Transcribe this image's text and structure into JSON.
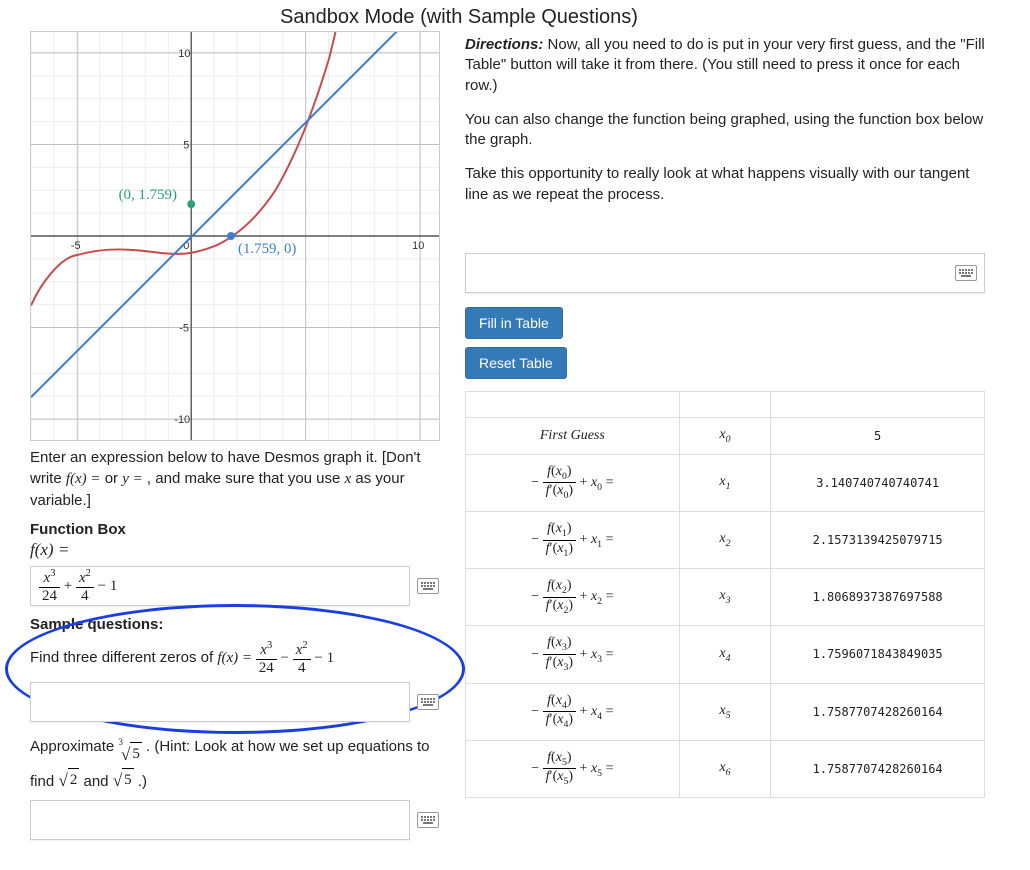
{
  "page": {
    "title": "Sandbox Mode (with Sample Questions)"
  },
  "directions": {
    "label": "Directions:",
    "p1": " Now, all you need to do is put in your very first guess, and the \"Fill Table\" button will take it from there. (You still need to press it once for each row.)",
    "p2": "You can also change the function being graphed, using the function box below the graph.",
    "p3": "Take this opportunity to really look at what happens visually with our tangent line as we repeat the process."
  },
  "graph": {
    "axis_ticks": [
      "10",
      "5",
      "-5",
      "0",
      "10",
      "-5",
      "-10"
    ],
    "pt1_label": "(0, 1.759)",
    "pt2_label": "(1.759, 0)"
  },
  "left_panel": {
    "enter_expr_a": "Enter an expression below to have Desmos graph it. [Don't write ",
    "enter_expr_b": " , and make sure that you use ",
    "enter_expr_c": " as your variable.]",
    "fx_eq": "f(x) =",
    "or": " or ",
    "y_eq": "y =",
    "x_var": "x",
    "fn_box_label": "Function Box",
    "fn_box_prefix": "f(x) =",
    "fn_box_value": "x³⁄24 + x²⁄4 − 1",
    "sample_heading": "Sample questions:",
    "sample_q1_a": "Find three different zeros of ",
    "sample_q1_b": "f(x) = ",
    "sample_q2_a": "Approximate ",
    "cube_root_5": "∛5",
    "sample_q2_b": " . (Hint: Look at how we set up equations to find ",
    "sqrt2": "√2",
    "and": " and ",
    "sqrt5": "√5",
    "sample_q2_c": " .)"
  },
  "controls": {
    "guess_value": "",
    "fill_btn": "Fill in Table",
    "reset_btn": "Reset Table"
  },
  "table": {
    "rows": [
      {
        "lhs": "first_guess",
        "xvar": "x₀",
        "val": "5"
      },
      {
        "lhs": "newton_0",
        "xvar": "x₁",
        "val": "3.140740740740741"
      },
      {
        "lhs": "newton_1",
        "xvar": "x₂",
        "val": "2.1573139425079715"
      },
      {
        "lhs": "newton_2",
        "xvar": "x₃",
        "val": "1.8068937387697588"
      },
      {
        "lhs": "newton_3",
        "xvar": "x₄",
        "val": "1.7596071843849035"
      },
      {
        "lhs": "newton_4",
        "xvar": "x₅",
        "val": "1.7587707428260164"
      },
      {
        "lhs": "newton_5",
        "xvar": "x₆",
        "val": "1.7587707428260164"
      }
    ],
    "first_guess_label": "First Guess"
  },
  "chart_data": {
    "type": "line",
    "title": "",
    "xlabel": "",
    "ylabel": "",
    "xlim": [
      -7,
      11
    ],
    "ylim": [
      -11,
      11
    ],
    "series": [
      {
        "name": "f(x) = x^3/24 + x^2/4 - 1",
        "color": "#c94a4a"
      },
      {
        "name": "tangent line at x0",
        "color": "#3b7dd8"
      }
    ],
    "annotations": [
      {
        "text": "(0, 1.759)",
        "x": 0,
        "y": 1.759,
        "color": "#2aa075"
      },
      {
        "text": "(1.759, 0)",
        "x": 1.759,
        "y": 0,
        "color": "#3b7dd8"
      }
    ],
    "axis_ticks_y": [
      -10,
      -5,
      0,
      5,
      10
    ],
    "axis_ticks_x": [
      -5,
      0,
      5,
      10
    ]
  }
}
